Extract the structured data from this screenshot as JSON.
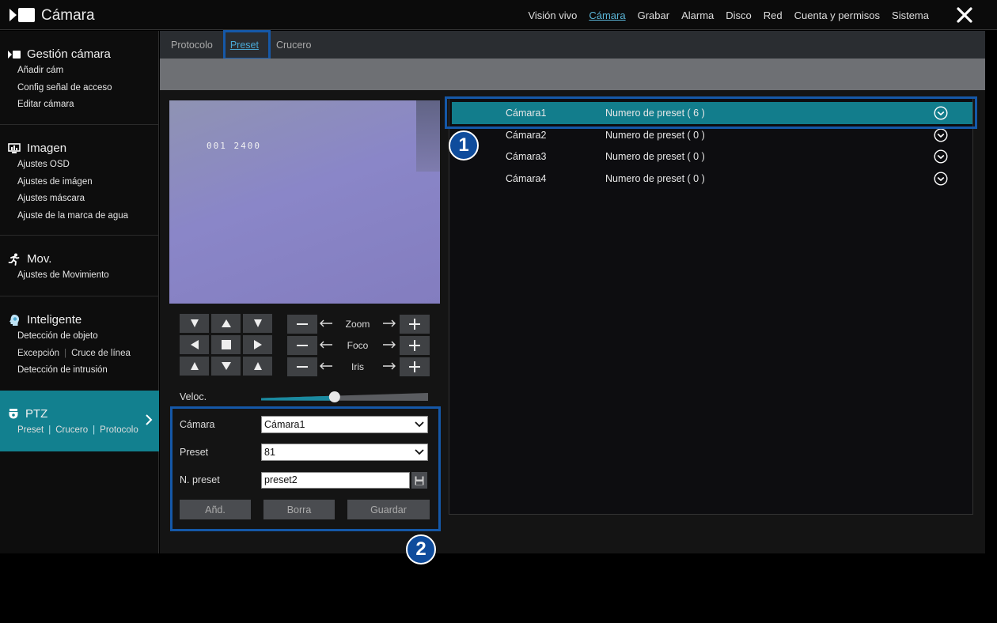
{
  "app": {
    "title": "Cámara"
  },
  "topnav": [
    {
      "label": "Visión vivo",
      "active": false
    },
    {
      "label": "Cámara",
      "active": true
    },
    {
      "label": "Grabar",
      "active": false
    },
    {
      "label": "Alarma",
      "active": false
    },
    {
      "label": "Disco",
      "active": false
    },
    {
      "label": "Red",
      "active": false
    },
    {
      "label": "Cuenta y permisos",
      "active": false
    },
    {
      "label": "Sistema",
      "active": false
    }
  ],
  "sidebar": {
    "gestion": {
      "title": "Gestión cámara",
      "items": [
        "Añadir cám",
        "Config señal de acceso",
        "Editar cámara"
      ]
    },
    "imagen": {
      "title": "Imagen",
      "items": [
        "Ajustes OSD",
        "Ajustes de imágen",
        "Ajustes máscara",
        "Ajuste de la marca de agua"
      ]
    },
    "mov": {
      "title": "Mov.",
      "items": [
        "Ajustes de Movimiento"
      ]
    },
    "inteligente": {
      "title": "Inteligente",
      "items": [
        "Detección de objeto",
        "Excepción",
        "Cruce de línea",
        "Detección de intrusión"
      ]
    },
    "ptz": {
      "title": "PTZ",
      "items": [
        "Preset",
        "Crucero",
        "Protocolo"
      ]
    }
  },
  "subtabs": [
    {
      "label": "Protocolo",
      "active": false
    },
    {
      "label": "Preset",
      "active": true
    },
    {
      "label": "Crucero",
      "active": false
    }
  ],
  "video": {
    "osd_text": "001 2400"
  },
  "lens": {
    "zoom": "Zoom",
    "focus": "Foco",
    "iris": "Iris"
  },
  "speed": {
    "label": "Veloc.",
    "level": 0.44
  },
  "form": {
    "camera_label": "Cámara",
    "camera_value": "Cámara1",
    "preset_label": "Preset",
    "preset_value": "81",
    "name_label": "N. preset",
    "name_value": "preset2",
    "add_button": "Añd.",
    "delete_button": "Borra",
    "save_button": "Guardar"
  },
  "cameras": [
    {
      "name": "Cámara1",
      "presets": "Numero de preset ( 6 )",
      "selected": true
    },
    {
      "name": "Cámara2",
      "presets": "Numero de preset ( 0 )",
      "selected": false
    },
    {
      "name": "Cámara3",
      "presets": "Numero de preset ( 0 )",
      "selected": false
    },
    {
      "name": "Cámara4",
      "presets": "Numero de preset ( 0 )",
      "selected": false
    }
  ],
  "callouts": {
    "one": "1",
    "two": "2"
  },
  "colors": {
    "accent": "#127d8c",
    "highlight_border": "#1558a8",
    "active_link": "#5bb6d8"
  }
}
